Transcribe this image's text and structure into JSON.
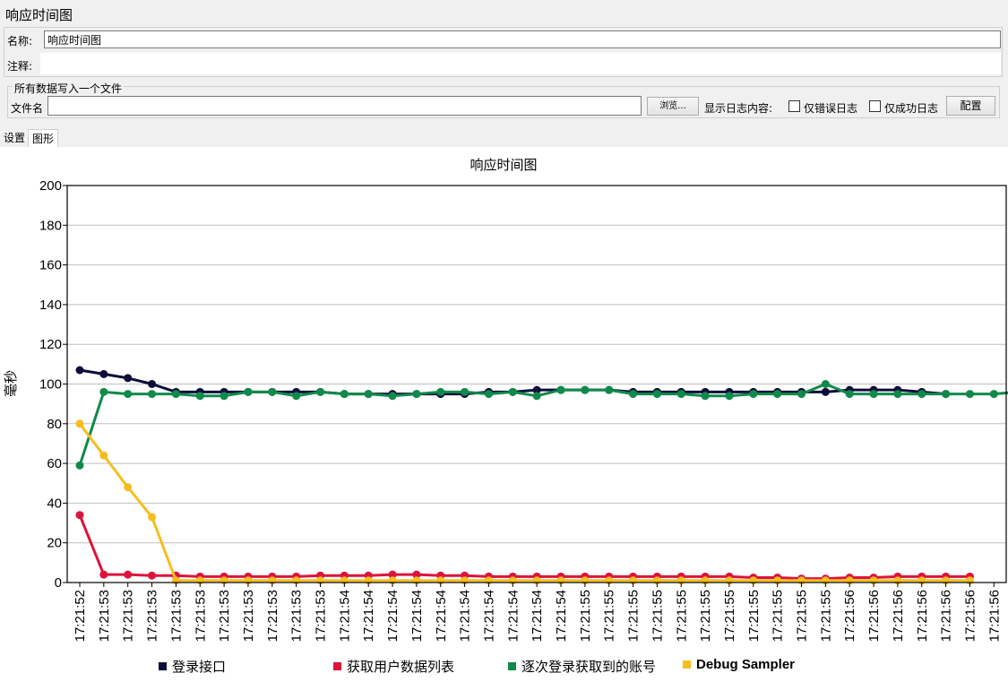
{
  "page": {
    "title": "响应时间图"
  },
  "name_panel": {
    "name_label": "名称:",
    "name_value": "响应时间图",
    "comment_label": "注释:",
    "comment_value": ""
  },
  "file_panel": {
    "legend": "所有数据写入一个文件",
    "filename_label": "文件名",
    "filename_value": "",
    "browse_label": "浏览...",
    "log_label": "显示日志内容:",
    "errors_only_label": "仅错误日志",
    "success_only_label": "仅成功日志",
    "configure_label": "配置"
  },
  "tabs": [
    {
      "label": "设置",
      "active": false
    },
    {
      "label": "图形",
      "active": true
    }
  ],
  "chart_data": {
    "type": "line",
    "title": "响应时间图",
    "ylabel": "毫秒",
    "xlabel": "",
    "ylim": [
      0,
      200
    ],
    "yticks": [
      0,
      20,
      40,
      60,
      80,
      100,
      120,
      140,
      160,
      180,
      200
    ],
    "grid": true,
    "legend_position": "bottom",
    "x": [
      "17:21:52",
      "17:21:53",
      "17:21:53",
      "17:21:53",
      "17:21:53",
      "17:21:53",
      "17:21:53",
      "17:21:53",
      "17:21:53",
      "17:21:53",
      "17:21:53",
      "17:21:54",
      "17:21:54",
      "17:21:54",
      "17:21:54",
      "17:21:54",
      "17:21:54",
      "17:21:54",
      "17:21:54",
      "17:21:54",
      "17:21:54",
      "17:21:55",
      "17:21:55",
      "17:21:55",
      "17:21:55",
      "17:21:55",
      "17:21:55",
      "17:21:55",
      "17:21:55",
      "17:21:55",
      "17:21:55",
      "17:21:55",
      "17:21:56",
      "17:21:56",
      "17:21:56",
      "17:21:56",
      "17:21:56",
      "17:21:56",
      "17:21:56",
      "17:21:56"
    ],
    "series": [
      {
        "name": "登录接口",
        "color": "#0d0d3a",
        "values": [
          107,
          105,
          103,
          100,
          96,
          96,
          96,
          96,
          96,
          96,
          96,
          95,
          95,
          95,
          95,
          95,
          95,
          96,
          96,
          97,
          97,
          97,
          97,
          96,
          96,
          96,
          96,
          96,
          96,
          96,
          96,
          96,
          97,
          97,
          97,
          96,
          95,
          null,
          null,
          null
        ]
      },
      {
        "name": "获取用户数据列表",
        "color": "#dc143c",
        "values": [
          34,
          4,
          4,
          3.5,
          3.5,
          3,
          3,
          3,
          3,
          3,
          3.5,
          3.5,
          3.5,
          4,
          4,
          3.5,
          3.5,
          3,
          3,
          3,
          3,
          3,
          3,
          3,
          3,
          3,
          3,
          3,
          2.5,
          2.5,
          2,
          2,
          2.5,
          2.5,
          3,
          3,
          3,
          3,
          null,
          null
        ]
      },
      {
        "name": "逐次登录获取到的账号",
        "color": "#108a4a",
        "values": [
          59,
          96,
          95,
          95,
          95,
          94,
          94,
          96,
          96,
          94,
          96,
          95,
          95,
          94,
          95,
          96,
          96,
          95,
          96,
          94,
          97,
          97,
          97,
          95,
          95,
          95,
          94,
          94,
          95,
          95,
          95,
          100,
          95,
          95,
          95,
          95,
          95,
          95,
          95,
          96
        ]
      },
      {
        "name": "Debug Sampler",
        "color": "#f6bd20",
        "values": [
          80,
          64,
          48,
          33,
          1,
          1,
          1,
          1,
          1,
          1,
          1,
          1,
          1,
          1,
          1,
          1,
          1,
          1,
          1,
          1,
          1,
          1,
          1,
          1,
          1,
          1,
          1,
          1,
          1,
          1,
          1,
          1,
          1,
          1,
          1,
          1,
          1,
          1,
          null,
          null
        ]
      }
    ]
  }
}
